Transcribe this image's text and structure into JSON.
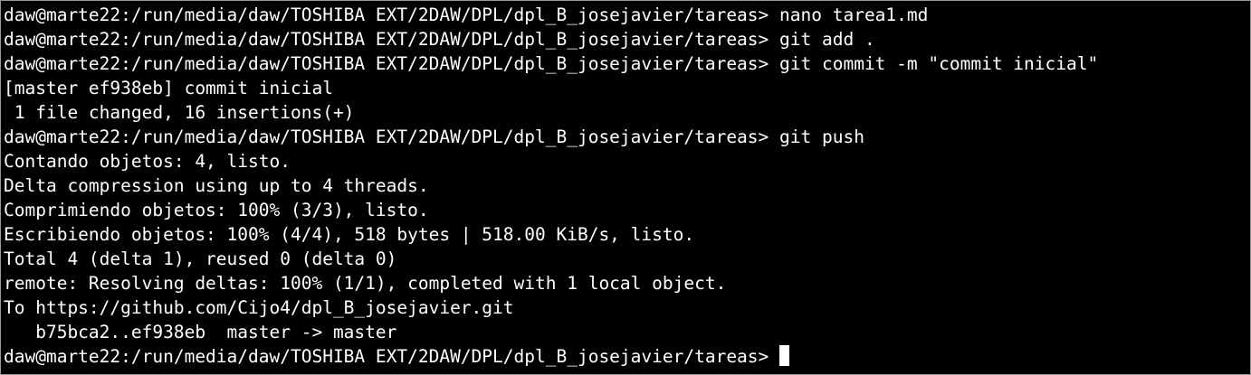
{
  "terminal": {
    "prompt": "daw@marte22:/run/media/daw/TOSHIBA EXT/2DAW/DPL/dpl_B_josejavier/tareas>",
    "lines": [
      "daw@marte22:/run/media/daw/TOSHIBA EXT/2DAW/DPL/dpl_B_josejavier/tareas> nano tarea1.md",
      "daw@marte22:/run/media/daw/TOSHIBA EXT/2DAW/DPL/dpl_B_josejavier/tareas> git add .",
      "daw@marte22:/run/media/daw/TOSHIBA EXT/2DAW/DPL/dpl_B_josejavier/tareas> git commit -m \"commit inicial\"",
      "[master ef938eb] commit inicial",
      " 1 file changed, 16 insertions(+)",
      "daw@marte22:/run/media/daw/TOSHIBA EXT/2DAW/DPL/dpl_B_josejavier/tareas> git push",
      "Contando objetos: 4, listo.",
      "Delta compression using up to 4 threads.",
      "Comprimiendo objetos: 100% (3/3), listo.",
      "Escribiendo objetos: 100% (4/4), 518 bytes | 518.00 KiB/s, listo.",
      "Total 4 (delta 1), reused 0 (delta 0)",
      "remote: Resolving deltas: 100% (1/1), completed with 1 local object.",
      "To https://github.com/Cijo4/dpl_B_josejavier.git",
      "   b75bca2..ef938eb  master -> master"
    ],
    "current_prompt": "daw@marte22:/run/media/daw/TOSHIBA EXT/2DAW/DPL/dpl_B_josejavier/tareas> ",
    "colors": {
      "background": "#000000",
      "foreground": "#ffffff",
      "cursor": "#ffffff"
    }
  }
}
